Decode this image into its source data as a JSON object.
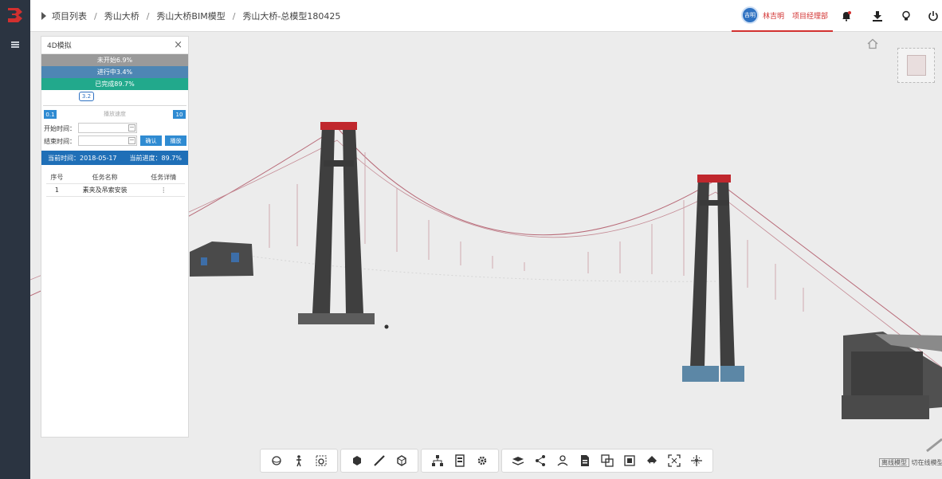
{
  "app": {
    "logo_color": "#d2302f"
  },
  "breadcrumb": {
    "items": [
      "项目列表",
      "秀山大桥",
      "秀山大桥BIM模型",
      "秀山大桥-总模型180425"
    ]
  },
  "user": {
    "avatar_text": "吉明",
    "name": "林吉明",
    "role": "项目经理部"
  },
  "header_icons": [
    "bell-icon",
    "download-icon",
    "bulb-icon",
    "power-icon"
  ],
  "panel": {
    "title": "4D模拟",
    "close": "×",
    "status": {
      "unstarted": "未开始6.9%",
      "in_progress": "进行中3.4%",
      "done": "已完成89.7%"
    },
    "slider_value": "3.2",
    "progress_fraction": 0.29,
    "speed": {
      "min": "0.1",
      "label": "播放速度",
      "max": "10"
    },
    "start_label": "开始时间：",
    "end_label": "结束时间：",
    "start_value": "",
    "end_value": "",
    "btn_confirm": "确认",
    "btn_play": "播放",
    "current_time_label": "当前时间：2018-05-17",
    "current_progress_label": "当前进度：89.7%",
    "table": {
      "headers": [
        "序号",
        "任务名称",
        "任务详情"
      ],
      "rows": [
        {
          "no": "1",
          "name": "素夹及吊索安装",
          "detail": "⋮"
        }
      ]
    }
  },
  "toolbar": {
    "groups": [
      [
        "orbit-icon",
        "walk-icon",
        "zoom-window-icon"
      ],
      [
        "explode-icon",
        "measure-icon",
        "section-box-icon"
      ],
      [
        "model-tree-icon",
        "properties-icon",
        "settings-icon"
      ],
      [
        "layers-icon",
        "share-icon",
        "markup-icon",
        "document-icon",
        "compare-icon",
        "cube-icon",
        "paint-icon",
        "fit-icon",
        "fullscreen-icon"
      ]
    ]
  },
  "bottom_links": {
    "left": "离线模型",
    "right": "切在线模型"
  }
}
